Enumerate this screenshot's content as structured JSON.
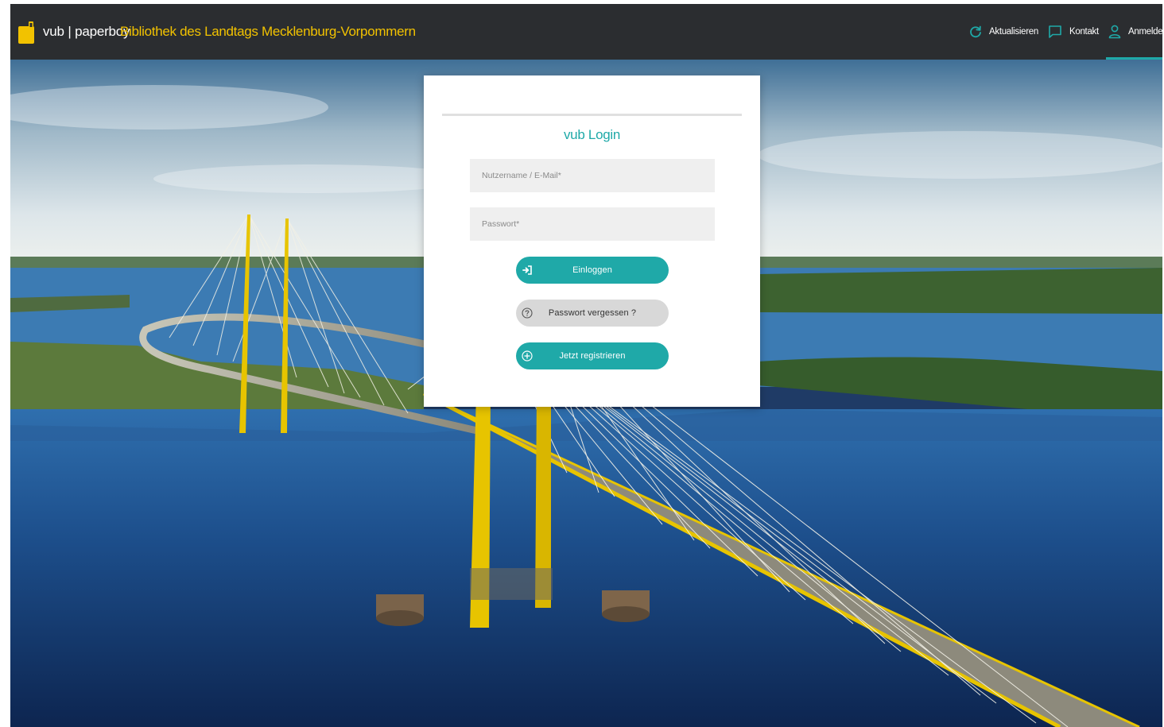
{
  "header": {
    "brand": "vub | paperboy",
    "library_name": "Bibliothek des Landtags Mecklenburg-Vorpommern",
    "nav": [
      {
        "label": "Aktualisieren",
        "icon": "refresh-icon"
      },
      {
        "label": "Kontakt",
        "icon": "chat-bubble-icon"
      },
      {
        "label": "Anmelden",
        "icon": "user-icon"
      }
    ]
  },
  "login": {
    "title": "vub Login",
    "username_placeholder": "Nutzername / E-Mail*",
    "password_placeholder": "Passwort*",
    "login_label": "Einloggen",
    "login_icon": "sign-in-icon",
    "forgot_label": "Passwort vergessen ?",
    "forgot_icon": "question-circle-icon",
    "register_label": "Jetzt registrieren",
    "register_icon": "plus-circle-icon"
  },
  "colors": {
    "accent": "#1fa9a8",
    "brand_yellow": "#f2c200",
    "topbar": "#2b2d30",
    "secondary_button": "#d8d8d8"
  }
}
